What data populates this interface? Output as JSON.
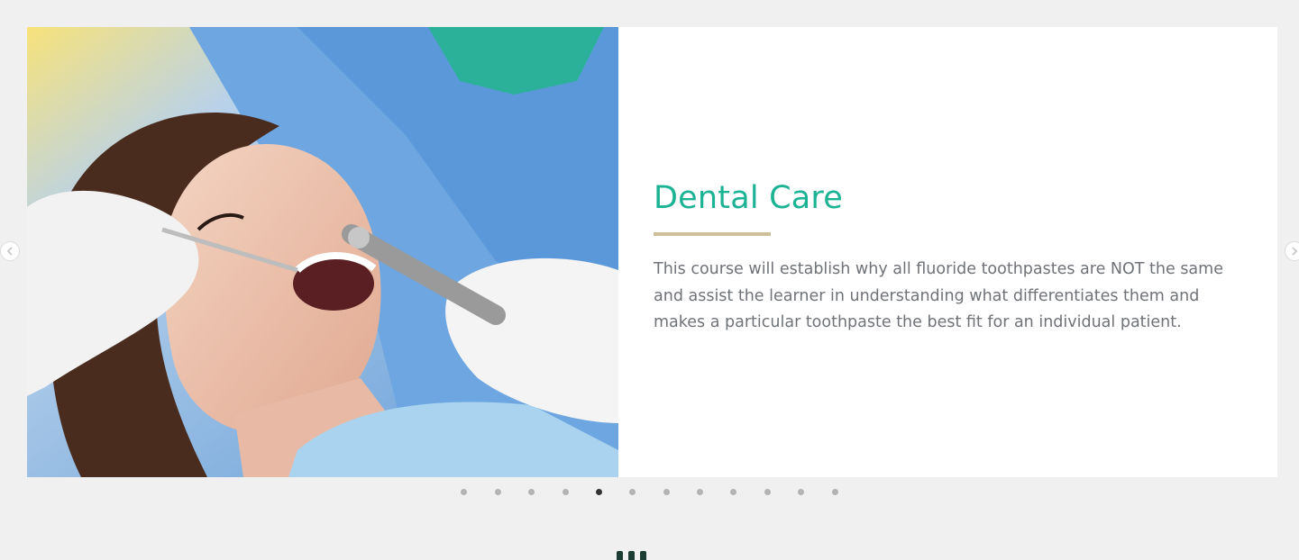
{
  "slider": {
    "title": "Dental Care",
    "description": "This course will establish why all fluoride toothpastes are NOT the same and assist the learner in understanding what differentiates them and makes a particular toothpaste the best fit for an individual patient.",
    "title_color": "#1bb394",
    "rule_color": "#cdbf99",
    "image_subject": "dentist examining patient",
    "prev_icon": "chevron-left-icon",
    "next_icon": "chevron-right-icon",
    "dots_total": 12,
    "active_dot": 5
  }
}
